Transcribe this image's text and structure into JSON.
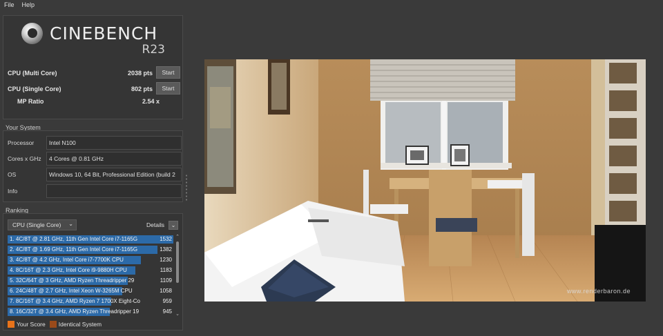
{
  "menu": [
    "File",
    "Help"
  ],
  "logo": {
    "name": "CINEBENCH",
    "version": "R23"
  },
  "scores": [
    {
      "label": "CPU (Multi Core)",
      "value": "2038 pts",
      "button": "Start"
    },
    {
      "label": "CPU (Single Core)",
      "value": "802 pts",
      "button": "Start"
    }
  ],
  "mp_ratio": {
    "label": "MP Ratio",
    "value": "2.54 x"
  },
  "system": {
    "title": "Your System",
    "rows": [
      {
        "label": "Processor",
        "value": "Intel N100"
      },
      {
        "label": "Cores x GHz",
        "value": "4 Cores @ 0.81 GHz"
      },
      {
        "label": "OS",
        "value": "Windows 10, 64 Bit, Professional Edition (build 2"
      },
      {
        "label": "Info",
        "value": ""
      }
    ]
  },
  "ranking": {
    "title": "Ranking",
    "selected_test": "CPU (Single Core)",
    "details_label": "Details",
    "max_score": 1532,
    "items": [
      {
        "name": "1. 4C/8T @ 2.81 GHz, 11th Gen Intel Core i7-1165G",
        "score": 1532
      },
      {
        "name": "2. 4C/8T @ 1.69 GHz, 11th Gen Intel Core i7-1165G",
        "score": 1382
      },
      {
        "name": "3. 4C/8T @ 4.2 GHz, Intel Core i7-7700K CPU",
        "score": 1230
      },
      {
        "name": "4. 8C/16T @ 2.3 GHz, Intel Core i9-9880H CPU",
        "score": 1183
      },
      {
        "name": "5. 32C/64T @ 3 GHz, AMD Ryzen Threadripper 29",
        "score": 1109
      },
      {
        "name": "6. 24C/48T @ 2.7 GHz, Intel Xeon W-3265M CPU",
        "score": 1058
      },
      {
        "name": "7. 8C/16T @ 3.4 GHz, AMD Ryzen 7 1700X Eight-Co",
        "score": 959
      },
      {
        "name": "8. 16C/32T @ 3.4 GHz, AMD Ryzen Threadripper 19",
        "score": 945
      }
    ],
    "legend": [
      {
        "label": "Your Score",
        "color": "#e8731a"
      },
      {
        "label": "Identical System",
        "color": "#9a4a1a"
      }
    ]
  },
  "render": {
    "watermark": "www.renderbaron.de"
  },
  "colors": {
    "rank_bar": "#2c6aa8",
    "background": "#3a3a3a"
  }
}
